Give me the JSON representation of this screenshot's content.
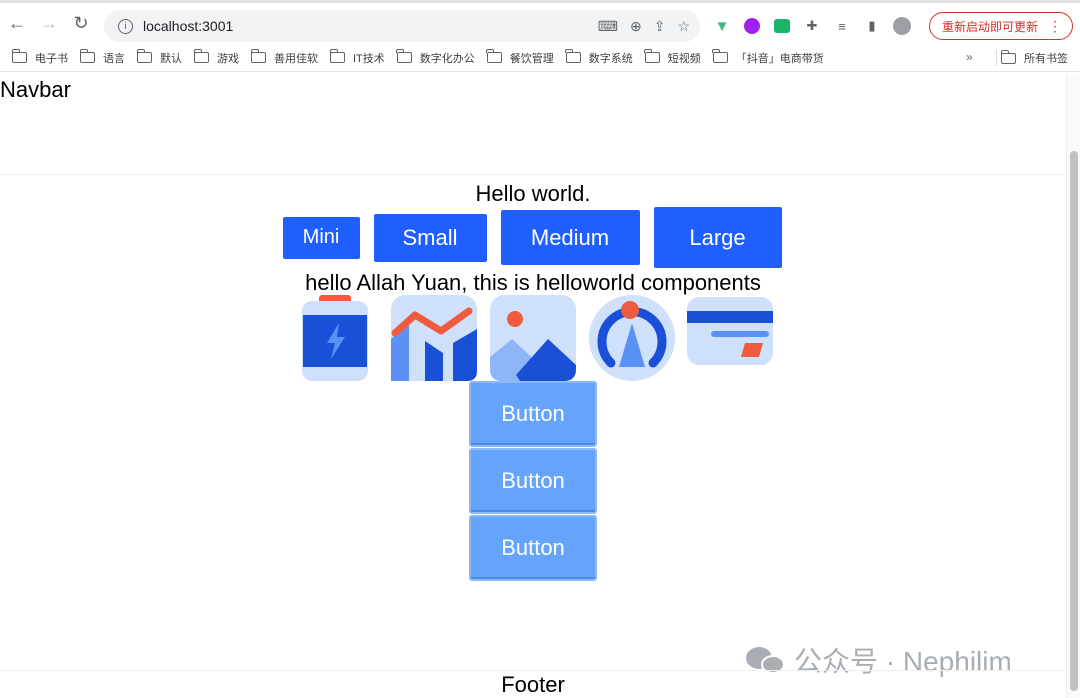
{
  "browser": {
    "url": "localhost:3001",
    "update_button": "重新启动即可更新",
    "bookmarks": [
      "电子书",
      "语言",
      "默认",
      "游戏",
      "善用佳软",
      "IT技术",
      "数字化办公",
      "餐饮管理",
      "数字系统",
      "短视频",
      "「抖音」电商带货"
    ],
    "bookmarks_more": "»",
    "all_bookmarks": "所有书签"
  },
  "page": {
    "navbar": "Navbar",
    "hello": "Hello world.",
    "size_buttons": [
      "Mini",
      "Small",
      "Medium",
      "Large"
    ],
    "subtitle": "hello Allah Yuan, this is helloworld components",
    "icons": [
      "battery-charging-icon",
      "line-bar-chart-icon",
      "image-icon",
      "compass-navigation-icon",
      "credit-card-icon"
    ],
    "stack_buttons": [
      "Button",
      "Button",
      "Button"
    ],
    "footer": "Footer",
    "watermark": "公众号 · Nephilim"
  },
  "colors": {
    "primary": "#1f5fff",
    "light_button": "#66a3fb",
    "icon_dark": "#1a4fd8",
    "icon_light": "#cfe0fb",
    "icon_accent": "#ef5b3d"
  }
}
